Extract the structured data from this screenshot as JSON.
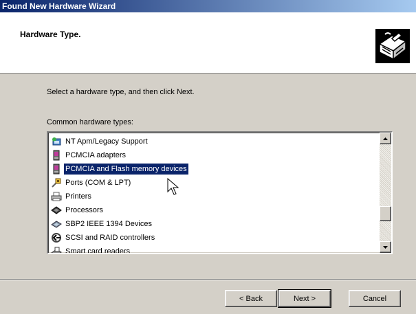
{
  "window": {
    "title": "Found New Hardware Wizard"
  },
  "header": {
    "title": "Hardware Type."
  },
  "main": {
    "instruction": "Select a hardware type, and then click Next.",
    "list_label": "Common hardware types:",
    "items": [
      {
        "label": "NT Apm/Legacy Support",
        "icon": "nt-apm-icon"
      },
      {
        "label": "PCMCIA adapters",
        "icon": "pcmcia-adapter-icon"
      },
      {
        "label": "PCMCIA and Flash memory devices",
        "icon": "pcmcia-flash-icon",
        "selected": true
      },
      {
        "label": "Ports (COM & LPT)",
        "icon": "port-icon"
      },
      {
        "label": "Printers",
        "icon": "printer-icon"
      },
      {
        "label": "Processors",
        "icon": "processor-icon"
      },
      {
        "label": "SBP2 IEEE 1394 Devices",
        "icon": "ieee1394-icon"
      },
      {
        "label": "SCSI and RAID controllers",
        "icon": "scsi-icon"
      },
      {
        "label": "Smart card readers",
        "icon": "smart-card-icon"
      }
    ]
  },
  "buttons": {
    "back": "< Back",
    "next": "Next >",
    "cancel": "Cancel"
  },
  "colors": {
    "titlebar_start": "#0a246a",
    "titlebar_end": "#a6caf0",
    "selection": "#0a246a",
    "face": "#d4d0c8"
  }
}
